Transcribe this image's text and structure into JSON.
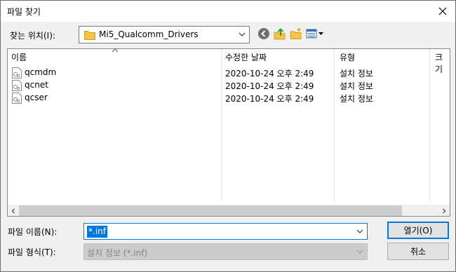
{
  "window": {
    "title": "파일 찾기"
  },
  "toolbar": {
    "look_in_label": "찾는 위치(I):",
    "look_in_value": "Mi5_Qualcomm_Drivers"
  },
  "list": {
    "columns": [
      "이름",
      "수정한 날짜",
      "유형",
      "크기"
    ],
    "rows": [
      {
        "name": "qcmdm",
        "date": "2020-10-24 오후 2:49",
        "type": "설치 정보"
      },
      {
        "name": "qcnet",
        "date": "2020-10-24 오후 2:49",
        "type": "설치 정보"
      },
      {
        "name": "qcser",
        "date": "2020-10-24 오후 2:49",
        "type": "설치 정보"
      }
    ]
  },
  "footer": {
    "filename_label": "파일 이름(N):",
    "filename_value": "*.inf",
    "filetype_label": "파일 형식(T):",
    "filetype_value": "설치 정보 (*.inf)",
    "open_label": "열기(O)",
    "cancel_label": "취소"
  },
  "colors": {
    "accent": "#0078d7",
    "folder": "#f3c34a"
  },
  "icons": [
    "close-icon",
    "folder-icon",
    "back-icon",
    "up-folder-icon",
    "new-folder-icon",
    "view-menu-icon",
    "setup-file-icon"
  ]
}
